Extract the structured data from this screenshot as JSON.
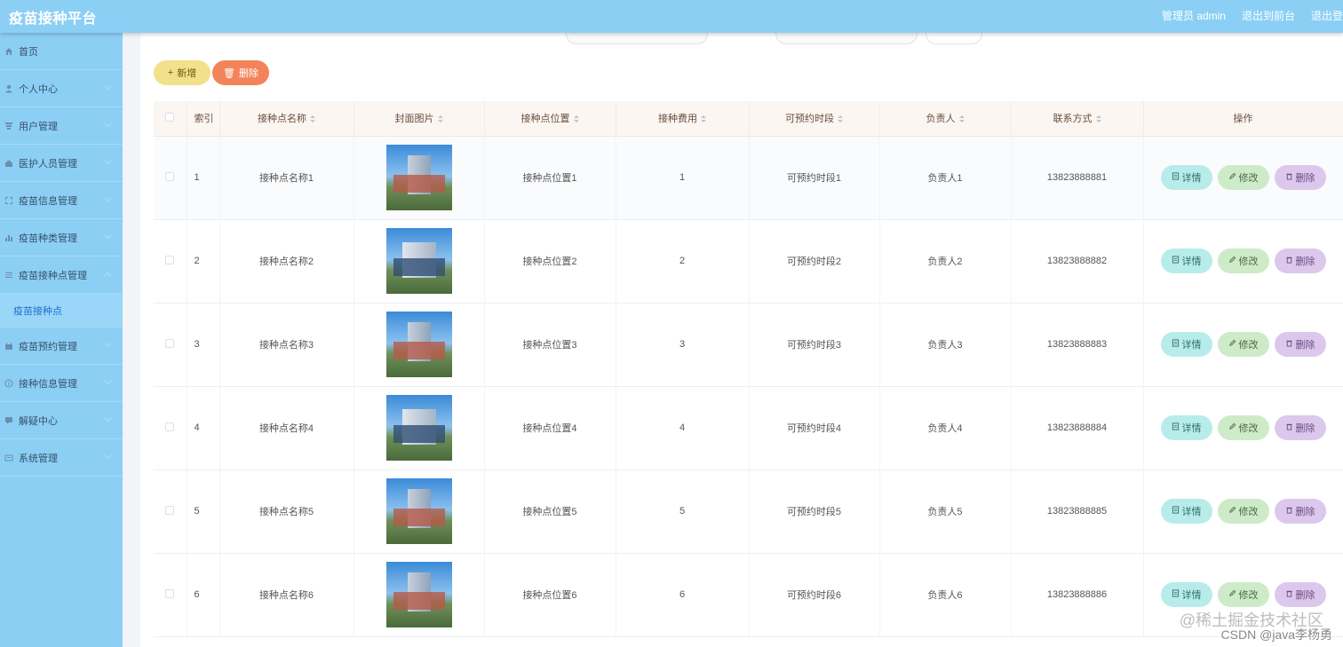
{
  "app": {
    "title": "疫苗接种平台"
  },
  "header": {
    "admin_label": "管理员 admin",
    "front_link": "退出到前台",
    "logout_link": "退出登"
  },
  "sidebar": {
    "items": [
      {
        "label": "首页",
        "icon": "home-icon"
      },
      {
        "label": "个人中心",
        "icon": "user-icon"
      },
      {
        "label": "用户管理",
        "icon": "users-icon"
      },
      {
        "label": "医护人员管理",
        "icon": "medical-staff-icon"
      },
      {
        "label": "疫苗信息管理",
        "icon": "vaccine-info-icon"
      },
      {
        "label": "疫苗种类管理",
        "icon": "bar-chart-icon"
      },
      {
        "label": "疫苗接种点管理",
        "icon": "list-icon"
      },
      {
        "label": "疫苗预约管理",
        "icon": "calendar-icon"
      },
      {
        "label": "接种信息管理",
        "icon": "info-icon"
      },
      {
        "label": "解疑中心",
        "icon": "question-icon"
      },
      {
        "label": "系统管理",
        "icon": "settings-icon"
      }
    ],
    "active_sub": "疫苗接种点"
  },
  "toolbar": {
    "add_label": "新增",
    "delete_label": "删除"
  },
  "table": {
    "headers": [
      "索引",
      "接种点名称",
      "封面图片",
      "接种点位置",
      "接种费用",
      "可预约时段",
      "负责人",
      "联系方式",
      "操作"
    ],
    "rows": [
      {
        "index": "1",
        "name": "接种点名称1",
        "location": "接种点位置1",
        "fee": "1",
        "slot": "可预约时段1",
        "owner": "负责人1",
        "phone": "13823888881"
      },
      {
        "index": "2",
        "name": "接种点名称2",
        "location": "接种点位置2",
        "fee": "2",
        "slot": "可预约时段2",
        "owner": "负责人2",
        "phone": "13823888882"
      },
      {
        "index": "3",
        "name": "接种点名称3",
        "location": "接种点位置3",
        "fee": "3",
        "slot": "可预约时段3",
        "owner": "负责人3",
        "phone": "13823888883"
      },
      {
        "index": "4",
        "name": "接种点名称4",
        "location": "接种点位置4",
        "fee": "4",
        "slot": "可预约时段4",
        "owner": "负责人4",
        "phone": "13823888884"
      },
      {
        "index": "5",
        "name": "接种点名称5",
        "location": "接种点位置5",
        "fee": "5",
        "slot": "可预约时段5",
        "owner": "负责人5",
        "phone": "13823888885"
      },
      {
        "index": "6",
        "name": "接种点名称6",
        "location": "接种点位置6",
        "fee": "6",
        "slot": "可预约时段6",
        "owner": "负责人6",
        "phone": "13823888886"
      }
    ],
    "actions": {
      "detail": "详情",
      "edit": "修改",
      "delete": "删除"
    }
  },
  "watermark": {
    "line1": "@稀土掘金技术社区",
    "line2": "CSDN @java李杨勇"
  },
  "colors": {
    "topbar": "#8ccff5",
    "sidebar": "#8ccff5",
    "add_button": "#f3e08a",
    "delete_button": "#f3845a",
    "detail_button": "#b8ecea",
    "edit_button": "#cdebc8",
    "remove_button": "#dcc8ec"
  }
}
